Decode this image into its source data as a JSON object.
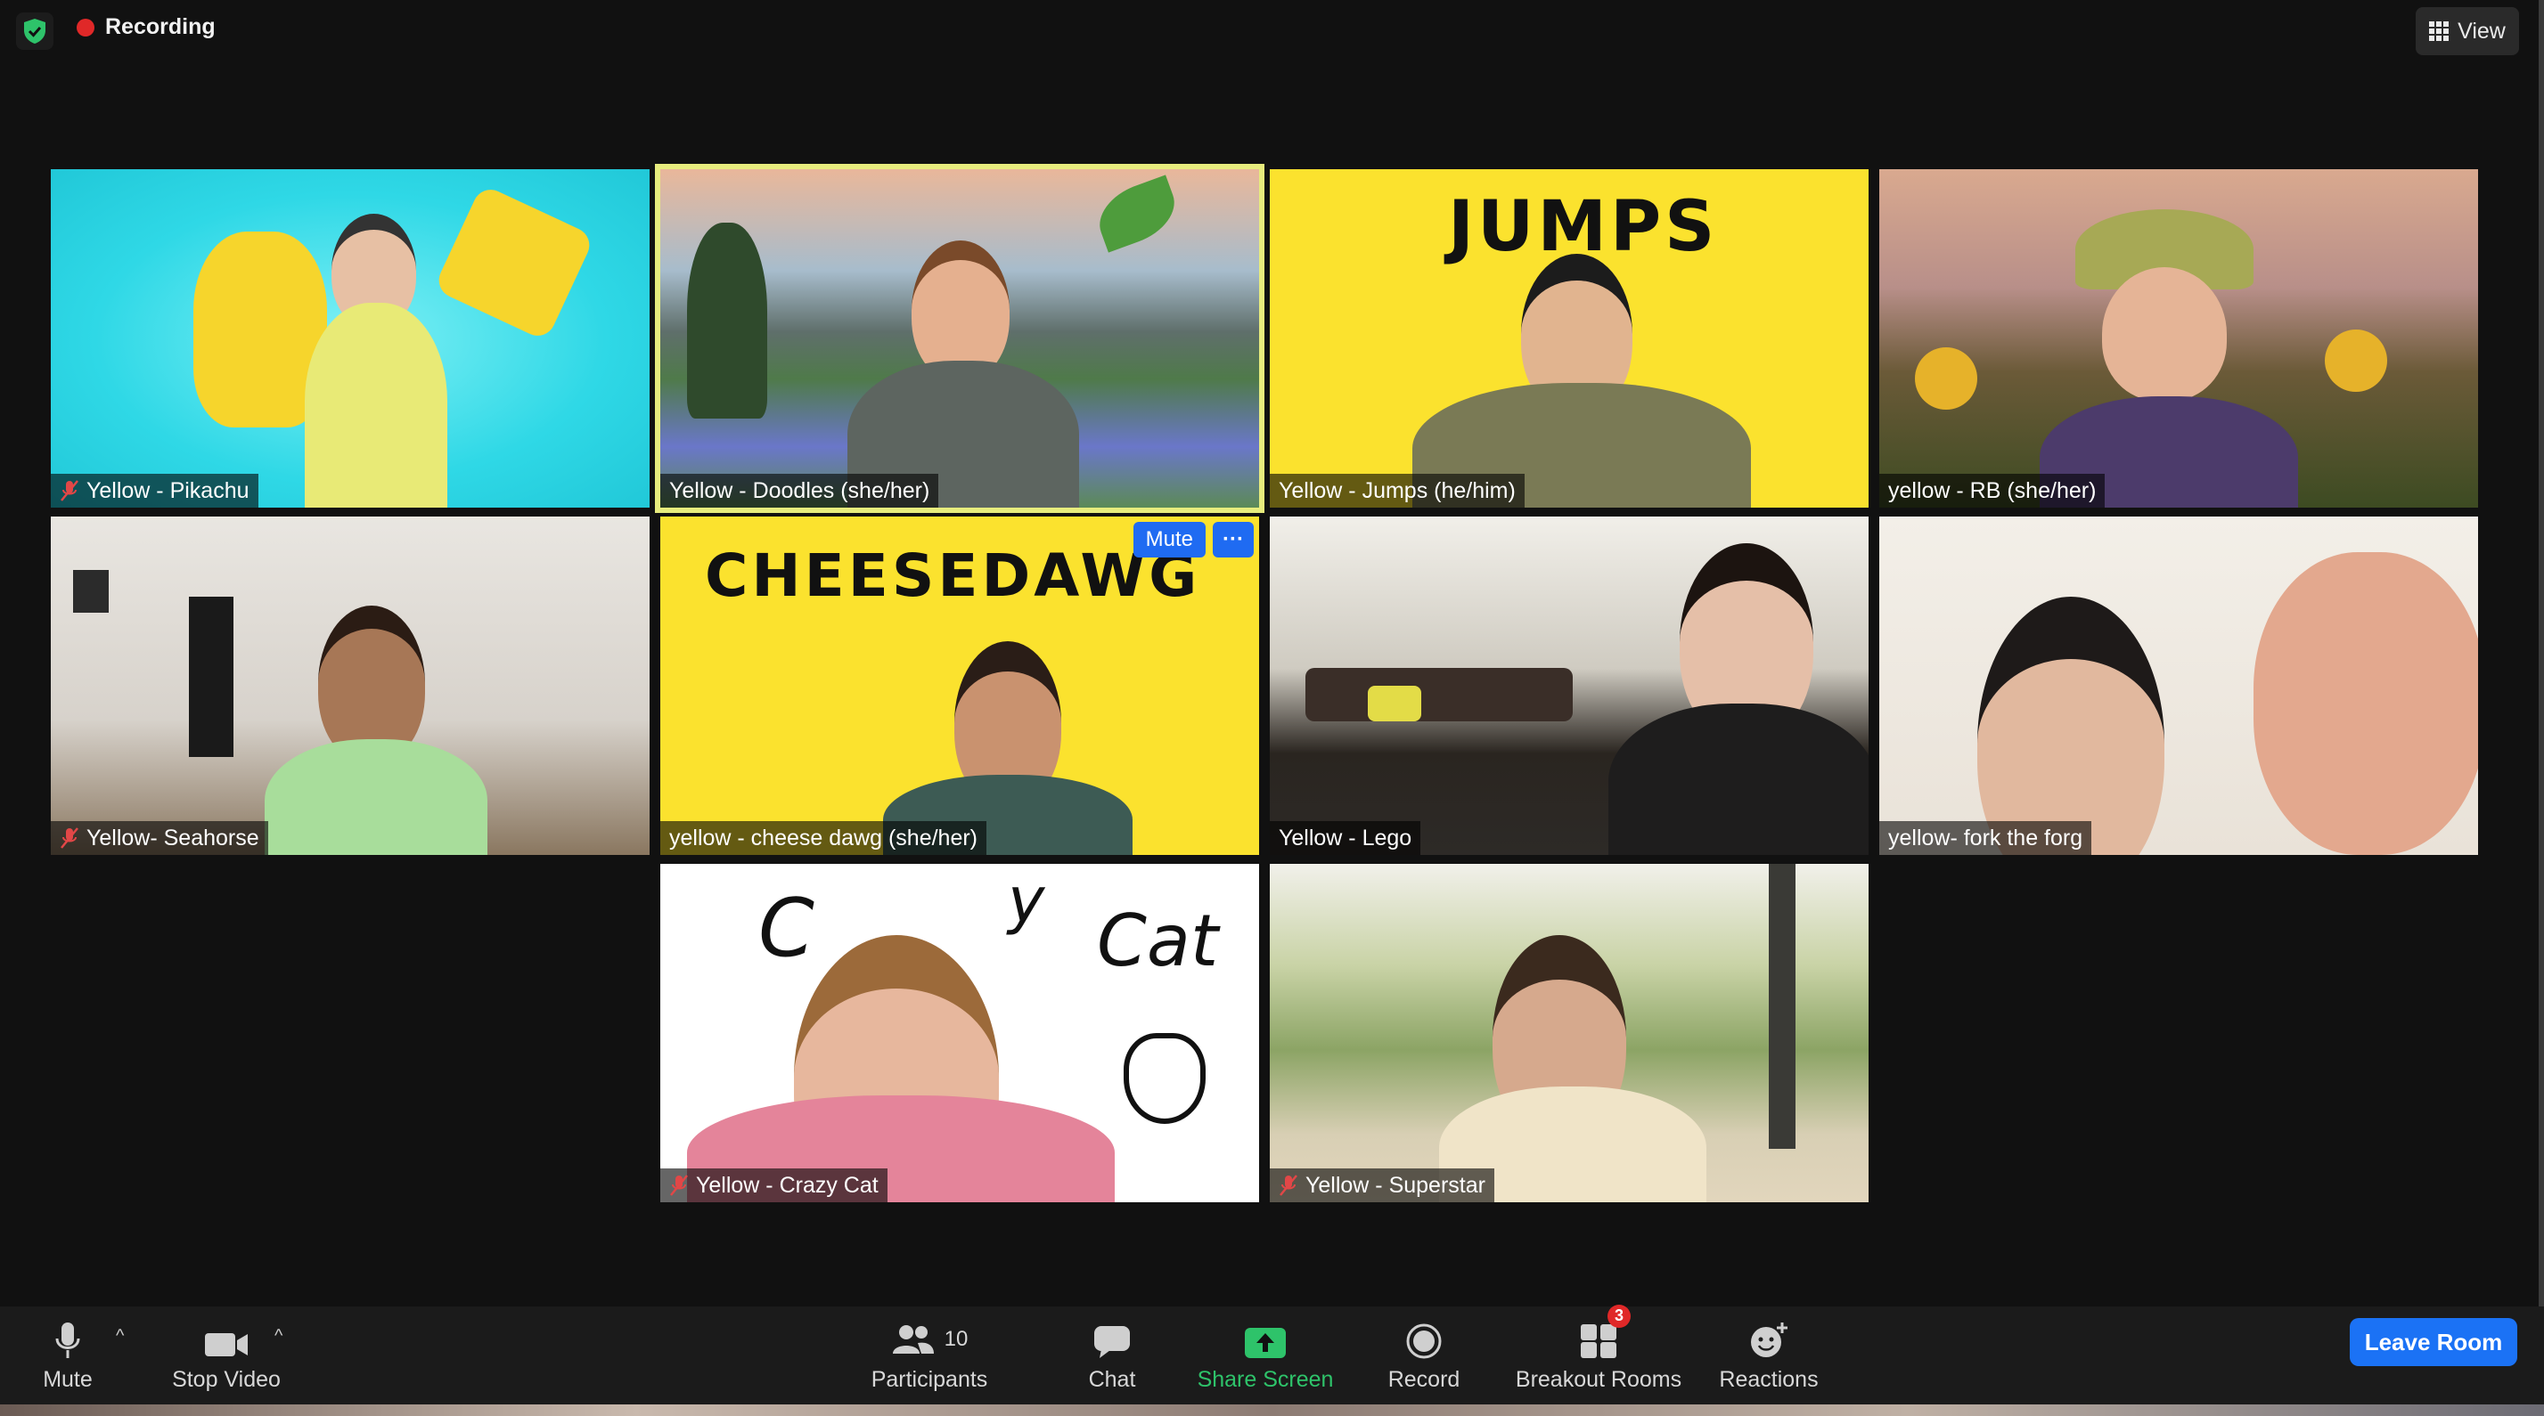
{
  "top": {
    "recording_label": "Recording",
    "view_label": "View",
    "icons": [
      "security-shield-icon",
      "recording-dot-icon",
      "grid-view-icon"
    ],
    "colors": {
      "recording": "#e02828",
      "shield": "#2ec36a"
    }
  },
  "participants": [
    {
      "name": "Yellow - Pikachu",
      "muted": true
    },
    {
      "name": "Yellow - Doodles (she/her)",
      "muted": false,
      "active_speaker": true
    },
    {
      "name": "Yellow - Jumps (he/him)",
      "muted": false,
      "background_text": "JUMPS"
    },
    {
      "name": "yellow - RB (she/her)",
      "muted": false
    },
    {
      "name": "Yellow- Seahorse",
      "muted": true
    },
    {
      "name": "yellow - cheese dawg (she/her)",
      "muted": false,
      "background_text": "CHEESEDAWG",
      "hover_mute": "Mute",
      "hover_more": "···"
    },
    {
      "name": "Yellow - Lego",
      "muted": false
    },
    {
      "name": "yellow- fork the forg",
      "muted": false
    },
    {
      "name": "Yellow - Crazy Cat",
      "muted": true,
      "background_text_1": "C",
      "background_text_2": "y",
      "background_text_3": "Cat"
    },
    {
      "name": "Yellow - Superstar",
      "muted": true
    }
  ],
  "toolbar": {
    "mute": "Mute",
    "stop_video": "Stop Video",
    "participants": "Participants",
    "participants_count": "10",
    "chat": "Chat",
    "share_screen": "Share Screen",
    "record": "Record",
    "breakout_rooms": "Breakout Rooms",
    "breakout_badge": "3",
    "reactions": "Reactions",
    "leave_room": "Leave Room",
    "caret": "^",
    "colors": {
      "share": "#2ec36a",
      "leave": "#1b72f5"
    }
  }
}
